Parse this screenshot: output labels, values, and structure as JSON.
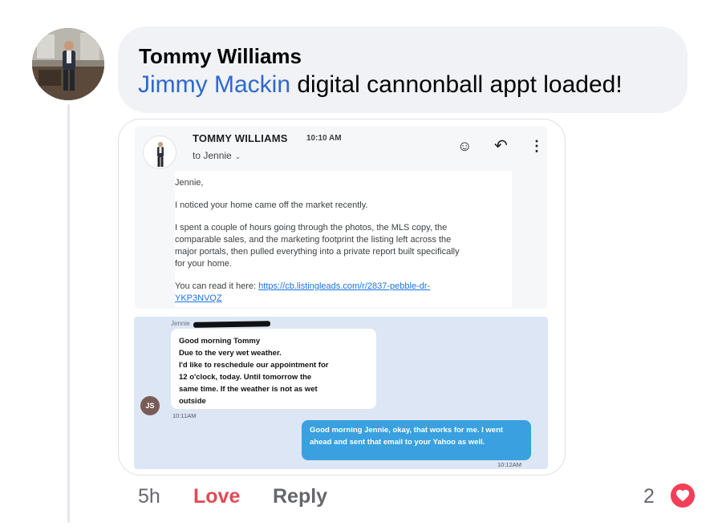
{
  "comment": {
    "author": "Tommy Williams",
    "mention": "Jimmy Mackin",
    "text": " digital cannonball appt loaded!"
  },
  "email": {
    "sender": "TOMMY WILLIAMS",
    "time": "10:10 AM",
    "to": "to Jennie",
    "icons": [
      "emoji-icon",
      "reply-icon",
      "more-vertical-icon"
    ],
    "body": {
      "greeting": "Jennie,",
      "para1": "I noticed your home came off the market recently.",
      "para2": "I spent a couple of hours going through the photos, the MLS copy, the comparable sales, and the marketing footprint the listing left across the major portals, then pulled everything into a private report built specifically for your home.",
      "read_prefix": "You can read it here: ",
      "link": "https://cb.listingleads.com/r/2837-pebble-dr-YKP3NVQZ"
    }
  },
  "chat": {
    "header_name": "Jennie",
    "incoming": {
      "lines": [
        "Good morning Tommy",
        "Due to the very wet weather.",
        "I'd like to reschedule our appointment for",
        "12 o'clock, today.  Until tomorrow the",
        "same time. If the weather is not as wet",
        "outside"
      ],
      "avatar_initials": "JS",
      "time": "10:11AM"
    },
    "outgoing": {
      "text": "Good morning Jennie, okay, that works for me. I went ahead and sent that email to your Yahoo as well.",
      "time": "10:12AM"
    }
  },
  "actions": {
    "time_ago": "5h",
    "love": "Love",
    "reply": "Reply",
    "reaction_count": "2"
  },
  "colors": {
    "mention": "#2d68d0",
    "love": "#e04a55",
    "reaction": "#f33e58",
    "outgoing_bubble": "#3aa0df",
    "chat_background": "#dce6f5"
  }
}
